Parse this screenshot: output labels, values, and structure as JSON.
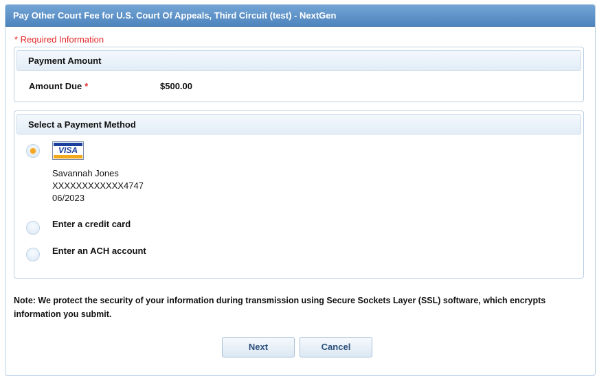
{
  "dialog": {
    "title": "Pay Other Court Fee for U.S. Court Of Appeals, Third Circuit (test) - NextGen"
  },
  "required_note": "* Required Information",
  "payment_amount": {
    "header": "Payment Amount",
    "amount_due_label": "Amount Due",
    "required_star": "*",
    "amount_due_value": "$500.00"
  },
  "payment_method": {
    "header": "Select a Payment Method",
    "saved_card": {
      "selected": true,
      "brand": "VISA",
      "holder": "Savannah Jones",
      "number": "XXXXXXXXXXXX4747",
      "expiry": "06/2023"
    },
    "options": [
      {
        "label": "Enter a credit card",
        "selected": false
      },
      {
        "label": "Enter an ACH account",
        "selected": false
      }
    ]
  },
  "note": "Note: We protect the security of your information during transmission using Secure Sockets Layer (SSL) software, which encrypts information you submit.",
  "buttons": {
    "next_label": "Next",
    "cancel_label": "Cancel"
  },
  "colors": {
    "title_bar": "#5b92c8",
    "required": "#e32626",
    "selected_radio": "#f5a623"
  }
}
